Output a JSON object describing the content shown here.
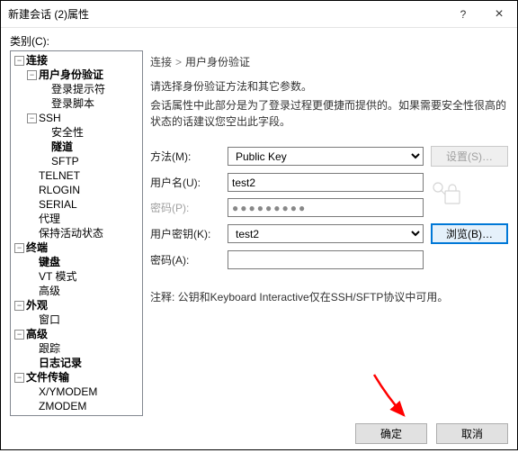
{
  "window": {
    "title": "新建会话 (2)属性"
  },
  "sys": {
    "help": "?",
    "close": "×"
  },
  "category_label": "类别(C):",
  "tree": {
    "connection": "连接",
    "auth": "用户身份验证",
    "login_prompt": "登录提示符",
    "login_script": "登录脚本",
    "ssh": "SSH",
    "security": "安全性",
    "tunnel": "隧道",
    "sftp": "SFTP",
    "telnet": "TELNET",
    "rlogin": "RLOGIN",
    "serial": "SERIAL",
    "proxy": "代理",
    "keep_alive": "保持活动状态",
    "terminal": "终端",
    "keyboard": "键盘",
    "vt": "VT 模式",
    "adv": "高级",
    "appearance": "外观",
    "windowp": "窗口",
    "adv2": "高级",
    "trace": "跟踪",
    "log": "日志记录",
    "ft": "文件传输",
    "xym": "X/YMODEM",
    "zm": "ZMODEM"
  },
  "crumb": {
    "root": "连接",
    "page": "用户身份验证"
  },
  "desc1": "请选择身份验证方法和其它参数。",
  "desc2": "会话属性中此部分是为了登录过程更便捷而提供的。如果需要安全性很高的状态的话建议您空出此字段。",
  "form": {
    "method_label": "方法(M):",
    "method_value": "Public Key",
    "settings_btn": "设置(S)…",
    "user_label": "用户名(U):",
    "user_value": "test2",
    "pass_label": "密码(P):",
    "pass_value": "●●●●●●●●●",
    "key_label": "用户密钥(K):",
    "key_value": "test2",
    "browse_btn": "浏览(B)…",
    "pass2_label": "密码(A):",
    "pass2_value": ""
  },
  "note": "注释: 公钥和Keyboard Interactive仅在SSH/SFTP协议中可用。",
  "footer": {
    "ok": "确定",
    "cancel": "取消"
  }
}
